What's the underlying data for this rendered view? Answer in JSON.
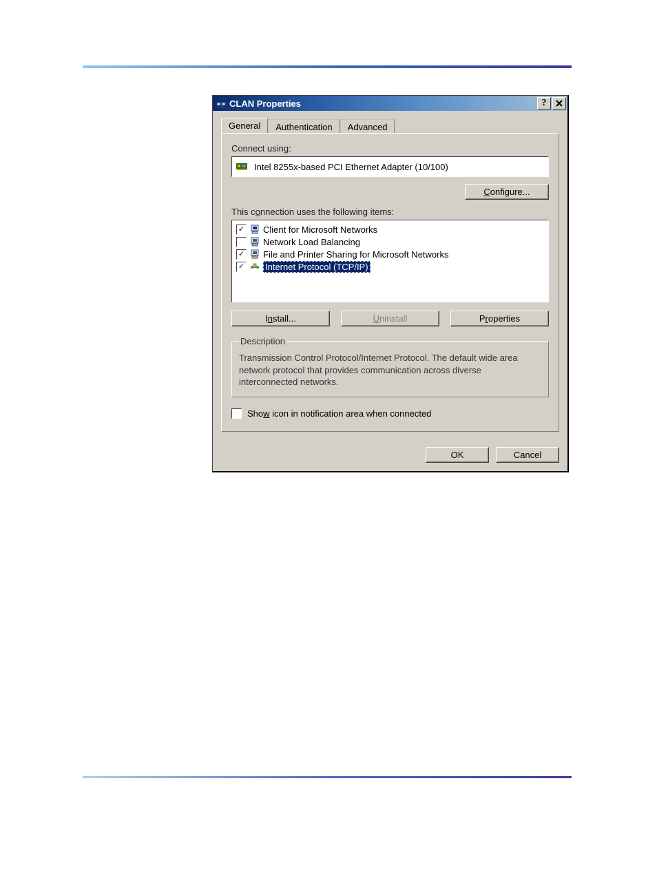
{
  "dialog": {
    "title": "CLAN Properties",
    "tabs": {
      "general": "General",
      "authentication": "Authentication",
      "advanced": "Advanced"
    },
    "connect_using_label": "Connect using:",
    "adapter_name": "Intel 8255x-based PCI Ethernet Adapter (10/100)",
    "configure_btn": "Configure...",
    "configure_accesskey_prefix": "C",
    "items_label": "This connection uses the following items:",
    "items_accesskey_char": "o",
    "items": [
      {
        "checked": true,
        "icon": "client-icon",
        "label": "Client for Microsoft Networks"
      },
      {
        "checked": false,
        "icon": "service-icon",
        "label": "Network Load Balancing"
      },
      {
        "checked": true,
        "icon": "service-icon",
        "label": "File and Printer Sharing for Microsoft Networks"
      },
      {
        "checked": true,
        "icon": "protocol-icon",
        "label": "Internet Protocol (TCP/IP)",
        "selected": true
      }
    ],
    "install_btn": "Install...",
    "uninstall_btn": "Uninstall",
    "properties_btn": "Properties",
    "description_legend": "Description",
    "description_text": "Transmission Control Protocol/Internet Protocol. The default wide area network protocol that provides communication across diverse interconnected networks.",
    "show_icon_label": "Show icon in notification area when connected",
    "show_icon_checked": false,
    "ok_btn": "OK",
    "cancel_btn": "Cancel"
  }
}
